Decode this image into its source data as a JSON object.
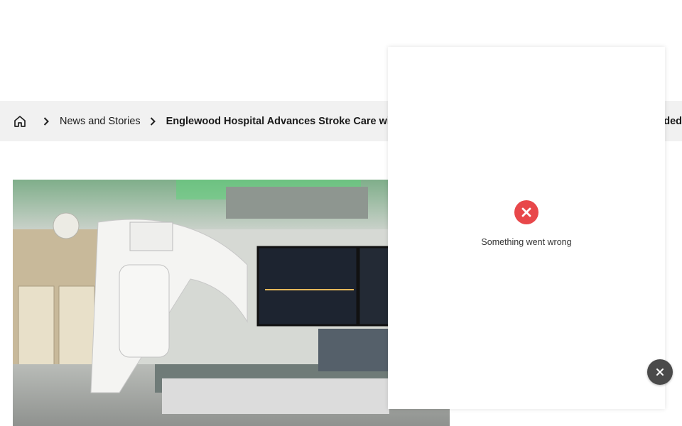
{
  "breadcrumb": {
    "home_icon": "home-icon",
    "separator_icon": "chevron-right-icon",
    "items": [
      {
        "label": "News and Stories"
      },
      {
        "label": "Englewood Hospital Advances Stroke Care with"
      }
    ],
    "overflow_fragment": "ded"
  },
  "hero_image": {
    "description_icon": "angiography-suite-photo"
  },
  "error_overlay": {
    "icon": "error-x-icon",
    "message": "Something went wrong",
    "colors": {
      "error": "#e8474a"
    }
  },
  "close_button": {
    "icon": "close-icon",
    "label": "×"
  }
}
